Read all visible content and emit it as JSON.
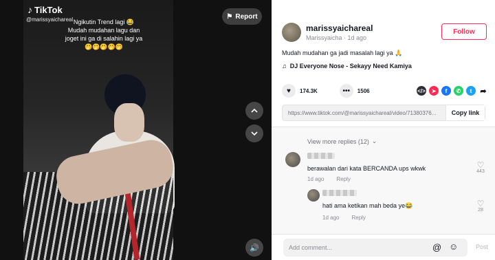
{
  "video": {
    "brand": "TikTok",
    "handle": "@marissyaichareal",
    "caption_lines": [
      "Ngikutin Trend lagi 😂",
      "Mudah mudahan lagu dan",
      "joget ini ga di salahin lagi ya",
      "🤭🤭🤭🤭🤭"
    ],
    "report_label": "Report"
  },
  "author": {
    "username": "marissyaichareal",
    "display_name": "Marissyaicha",
    "posted": "1d ago",
    "follow_label": "Follow"
  },
  "post": {
    "description": "Mudah mudahan ga jadi masalah lagi ya 🙏",
    "music": "DJ Everyone Nose - Sekayy Need Kamiya"
  },
  "stats": {
    "likes": "174.3K",
    "comments": "1506"
  },
  "share": {
    "icons": [
      {
        "name": "embed-icon",
        "glyph": "</>",
        "color": "#2f2f38"
      },
      {
        "name": "send-icon",
        "glyph": "➤",
        "color": "#fe2c55"
      },
      {
        "name": "facebook-icon",
        "glyph": "f",
        "color": "#1877f2"
      },
      {
        "name": "whatsapp-icon",
        "glyph": "✆",
        "color": "#25d366"
      },
      {
        "name": "twitter-icon",
        "glyph": "t",
        "color": "#1da1f2"
      },
      {
        "name": "share-arrow-icon",
        "glyph": "➦",
        "color": "#ffffff"
      }
    ]
  },
  "link": {
    "url": "https://www.tiktok.com/@marissyaichareal/video/71380376...",
    "copy_label": "Copy link"
  },
  "comments": {
    "view_more": "View more replies (12)",
    "items": [
      {
        "text": "berawalan dari kata BERCANDA ups wkwk",
        "time": "1d ago",
        "reply": "Reply",
        "likes": "443"
      },
      {
        "text": "hati ama ketikan mah beda ye😂",
        "time": "1d ago",
        "reply": "Reply",
        "likes": "28"
      }
    ]
  },
  "composer": {
    "placeholder": "Add comment...",
    "post_label": "Post"
  },
  "colors": {
    "accent": "#fe2c55",
    "text": "#161823",
    "muted": "#8a8b91"
  }
}
